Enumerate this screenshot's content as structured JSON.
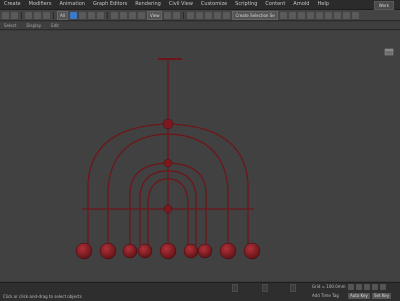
{
  "menubar": {
    "items": [
      "Create",
      "Modifiers",
      "Animation",
      "Graph Editors",
      "Rendering",
      "Civil View",
      "Customize",
      "Scripting",
      "Content",
      "Arnold",
      "Help"
    ],
    "workspace": "Work"
  },
  "toolbar": {
    "filter_select": "All",
    "view_select": "View",
    "named_selection_select": "Create Selection Se"
  },
  "ribbon": {
    "labels": [
      "Select",
      "Display",
      "Edit"
    ]
  },
  "viewport": {
    "label": ""
  },
  "statusbar": {
    "prompt": "Click or click-and-drag to select objects",
    "grid_text": "Grid = 100.0mm",
    "time_tag": "Add Time Tag",
    "auto_key": "Auto Key",
    "set_key": "Set Key"
  },
  "colors": {
    "model": "#7a1a1f",
    "model_highlight": "#b03038",
    "viewport_bg": "#414141"
  }
}
